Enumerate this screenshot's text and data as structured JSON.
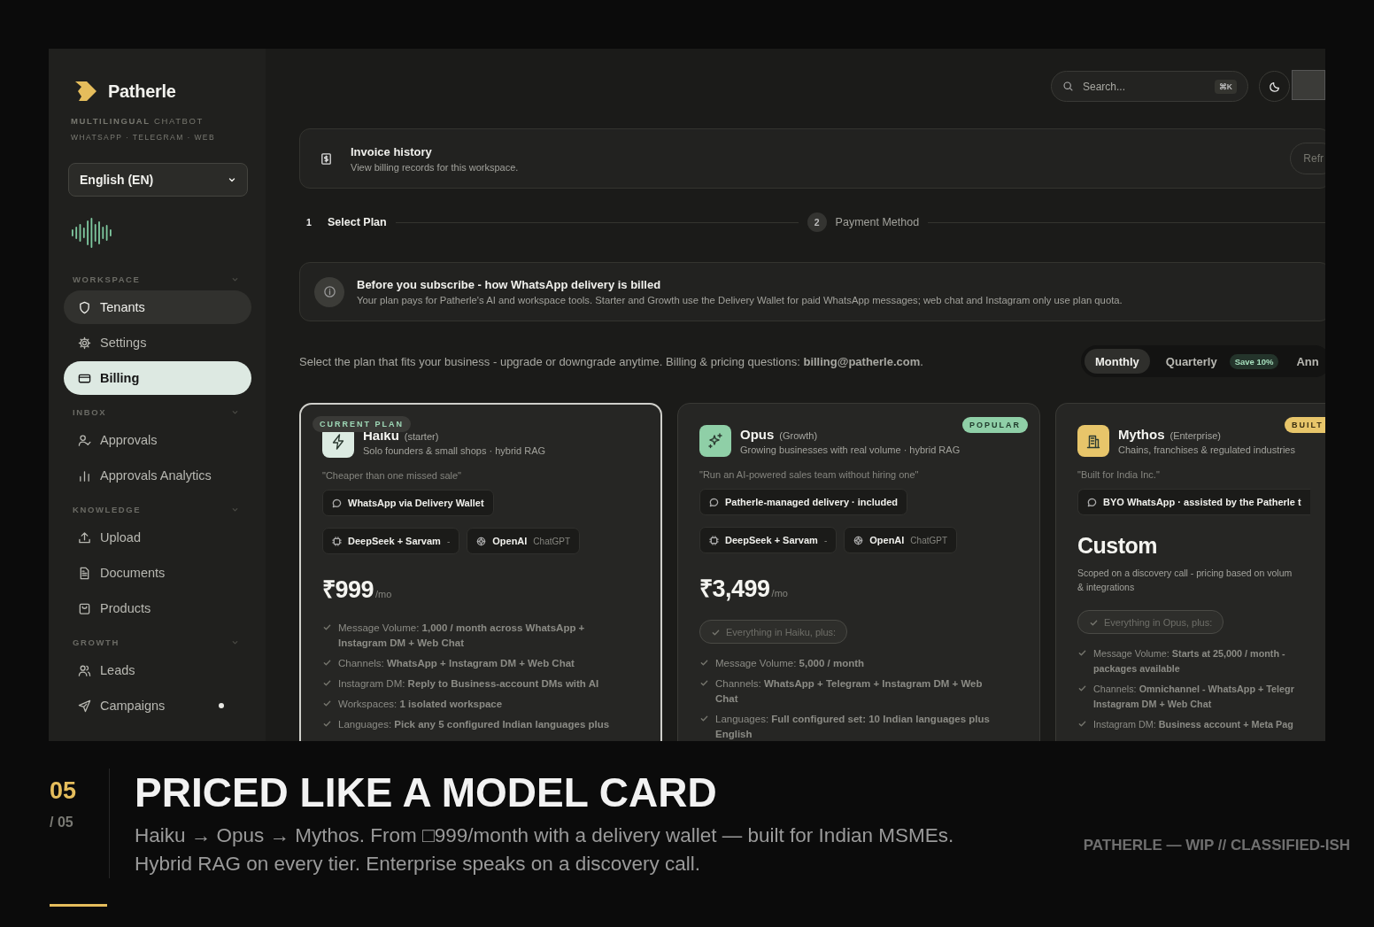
{
  "app": {
    "sidebar": {
      "brand": "Patherle",
      "tagline": "**MULTILINGUAL** CHATBOT",
      "channels": "WHATSAPP · TELEGRAM · WEB",
      "language": "English (EN)",
      "sections": [
        {
          "title": "WORKSPACE",
          "items": [
            {
              "label": "Tenants",
              "selected": false,
              "hovered": true,
              "dot": false
            },
            {
              "label": "Settings",
              "selected": false,
              "hovered": false,
              "dot": false
            },
            {
              "label": "Billing",
              "selected": true,
              "hovered": false,
              "dot": false
            }
          ]
        },
        {
          "title": "INBOX",
          "items": [
            {
              "label": "Approvals",
              "selected": false,
              "hovered": false,
              "dot": false
            },
            {
              "label": "Approvals Analytics",
              "selected": false,
              "hovered": false,
              "dot": false
            }
          ]
        },
        {
          "title": "KNOWLEDGE",
          "items": [
            {
              "label": "Upload",
              "selected": false,
              "hovered": false,
              "dot": false
            },
            {
              "label": "Documents",
              "selected": false,
              "hovered": false,
              "dot": false
            },
            {
              "label": "Products",
              "selected": false,
              "hovered": false,
              "dot": false
            }
          ]
        },
        {
          "title": "GROWTH",
          "items": [
            {
              "label": "Leads",
              "selected": false,
              "hovered": false,
              "dot": false
            },
            {
              "label": "Campaigns",
              "selected": false,
              "hovered": false,
              "dot": true
            }
          ]
        }
      ]
    },
    "search": {
      "placeholder": "Search...",
      "shortcut": "⌘K"
    },
    "invoice": {
      "title": "Invoice history",
      "subtitle": "View billing records for this workspace.",
      "button": "Refr"
    },
    "steps": [
      {
        "number": "1",
        "label": "Select Plan",
        "selected": true
      },
      {
        "number": "2",
        "label": "Payment Method",
        "selected": false
      }
    ],
    "notice": {
      "title": "Before you subscribe - how WhatsApp delivery is billed",
      "body": "Your plan pays for Patherle's AI and workspace tools. Starter and Growth use the Delivery Wallet for paid WhatsApp messages; web chat and Instagram only use plan quota."
    },
    "intro": "Select the plan that fits your business - upgrade or downgrade anytime. Billing & pricing questions: **billing@patherle.com**.",
    "billing_periods": [
      {
        "label": "Monthly",
        "selected": true
      },
      {
        "label": "Quarterly",
        "badge": "Save 10%",
        "selected": false
      },
      {
        "label": "Ann",
        "selected": false
      }
    ],
    "plans": [
      {
        "badge": "CURRENT PLAN",
        "current": true,
        "color": "#dcebe2",
        "name": "Haiku",
        "tier": "(starter)",
        "audience": "Solo founders & small shops · hybrid RAG",
        "quote": "\"Cheaper than one missed sale\"",
        "delivery": "WhatsApp via Delivery Wallet",
        "models": [
          {
            "name": "DeepSeek + Sarvam",
            "note": "-"
          },
          {
            "name": "OpenAI",
            "note": "ChatGPT"
          }
        ],
        "price": "₹999",
        "period": "/mo",
        "features": [
          "Message Volume: **1,000 / month across WhatsApp + Instagram DM + Web Chat**",
          "Channels: **WhatsApp + Instagram DM + Web Chat**",
          "Instagram DM: **Reply to Business-account DMs with AI**",
          "Workspaces: **1 isolated workspace**",
          "Languages: **Pick any 5 configured Indian languages plus**"
        ]
      },
      {
        "badge": "POPULAR",
        "current": false,
        "color": "#8fcfa7",
        "name": "Opus",
        "tier": "(Growth)",
        "audience": "Growing businesses with real volume · hybrid RAG",
        "quote": "\"Run an AI-powered sales team without hiring one\"",
        "delivery": "Patherle-managed delivery · included",
        "models": [
          {
            "name": "DeepSeek + Sarvam",
            "note": "-"
          },
          {
            "name": "OpenAI",
            "note": "ChatGPT"
          }
        ],
        "price": "₹3,499",
        "period": "/mo",
        "inherits": "Everything in Haiku, plus:",
        "features": [
          "Message Volume: **5,000 / month**",
          "Channels: **WhatsApp + Telegram + Instagram DM + Web Chat**",
          "Languages: **Full configured set: 10 Indian languages plus English**"
        ]
      },
      {
        "badge": "BUILT",
        "current": false,
        "color": "#e7c56a",
        "name": "Mythos",
        "tier": "(Enterprise)",
        "audience": "Chains, franchises & regulated industries",
        "quote": "\"Built for India Inc.\"",
        "delivery": "BYO WhatsApp · assisted by the Patherle t",
        "custom_price": "Custom",
        "price_note": "Scoped on a discovery call - pricing based on volum\n& integrations",
        "inherits": "Everything in Opus, plus:",
        "features": [
          "Message Volume: **Starts at 25,000 / month -**\n**packages available**",
          "Channels: **Omnichannel - WhatsApp + Telegr**\n**Instagram DM + Web Chat**",
          "Instagram DM: **Business account + Meta Pag**"
        ]
      }
    ]
  },
  "slide": {
    "number": "05",
    "total": "/ 05",
    "title": "PRICED LIKE A MODEL CARD",
    "subtitle": [
      "Haiku → Opus → Mythos. From □999/month with a delivery wallet — built for Indian MSMEs.",
      "Hybrid RAG on every tier. Enterprise speaks on a discovery call."
    ],
    "tag": "PATHERLE — WIP // CLASSIFIED-ISH"
  }
}
